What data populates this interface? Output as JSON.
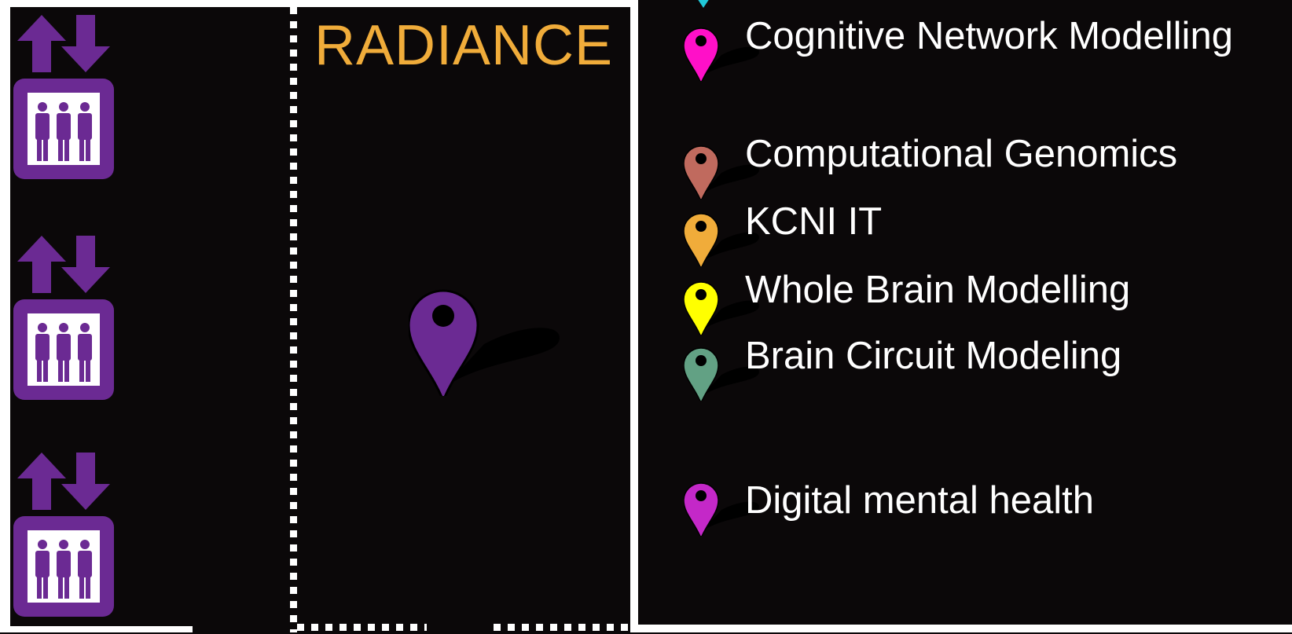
{
  "floor_plan": {
    "room_name": "RADIANCE",
    "room_name_color": "#f0ac3a",
    "elevator_icon": "elevator-icon",
    "elevator_color": "#6b2a93",
    "room_marker_icon": "map-pin-icon",
    "room_marker_color": "#6b2a93"
  },
  "legend": {
    "items": [
      {
        "label": "Cognitive Network Modelling",
        "color": "#ff10c8",
        "icon": "map-pin-icon"
      },
      {
        "label": "Computational Genomics",
        "color": "#c06a5e",
        "icon": "map-pin-icon"
      },
      {
        "label": "KCNI IT",
        "color": "#f0ac3a",
        "icon": "map-pin-icon"
      },
      {
        "label": "Whole Brain Modelling",
        "color": "#ffff00",
        "icon": "map-pin-icon"
      },
      {
        "label": "Brain Circuit Modeling",
        "color": "#62a184",
        "icon": "map-pin-icon"
      },
      {
        "label": "Digital mental health",
        "color": "#c428c8",
        "icon": "map-pin-icon"
      }
    ],
    "partial_pin_color": "#20c8d8"
  }
}
